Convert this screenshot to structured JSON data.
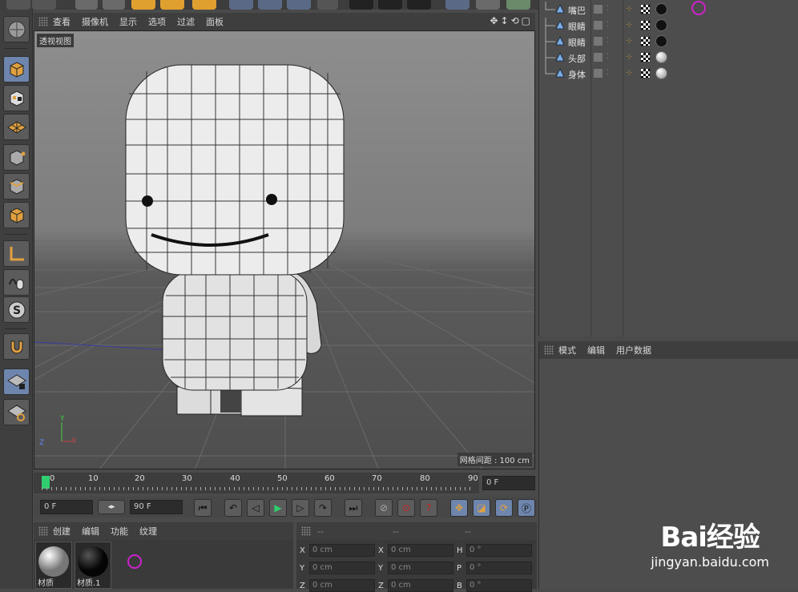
{
  "viewport": {
    "menu": [
      "查看",
      "摄像机",
      "显示",
      "选项",
      "过滤",
      "面板"
    ],
    "view_name": "透视视图",
    "grid_spacing": "网格间距 : 100 cm"
  },
  "timeline": {
    "ticks": [
      "0",
      "10",
      "20",
      "30",
      "40",
      "50",
      "60",
      "70",
      "80",
      "90"
    ],
    "current_frame": "0 F"
  },
  "playback": {
    "start_frame": "0 F",
    "end_frame": "90 F"
  },
  "material_manager": {
    "menu": [
      "创建",
      "编辑",
      "功能",
      "纹理"
    ],
    "materials": [
      {
        "name": "材质",
        "color": "#d6d6d6"
      },
      {
        "name": "材质.1",
        "color": "#111111"
      }
    ]
  },
  "coordinates": {
    "headers": [
      "--",
      "--",
      "--"
    ],
    "rows": [
      {
        "l1": "X",
        "v1": "0 cm",
        "l2": "X",
        "v2": "0 cm",
        "l3": "H",
        "v3": "0 °"
      },
      {
        "l1": "Y",
        "v1": "0 cm",
        "l2": "Y",
        "v2": "0 cm",
        "l3": "P",
        "v3": "0 °"
      },
      {
        "l1": "Z",
        "v1": "0 cm",
        "l2": "Z",
        "v2": "0 cm",
        "l3": "B",
        "v3": "0 °"
      }
    ]
  },
  "object_manager": {
    "objects": [
      {
        "name": "嘴巴",
        "material": "black"
      },
      {
        "name": "眼睛",
        "material": "black"
      },
      {
        "name": "眼睛",
        "material": "black"
      },
      {
        "name": "头部",
        "material": "white"
      },
      {
        "name": "身体",
        "material": "white"
      }
    ]
  },
  "attribute_manager": {
    "menu": [
      "模式",
      "编辑",
      "用户数据"
    ]
  },
  "watermark": {
    "main": "Bai经验",
    "sub": "jingyan.baidu.com"
  },
  "colors": {
    "accent_blue": "#6e86ad",
    "panel_dark": "#3e3e3e",
    "annotation_magenta": "#cc22cc"
  }
}
